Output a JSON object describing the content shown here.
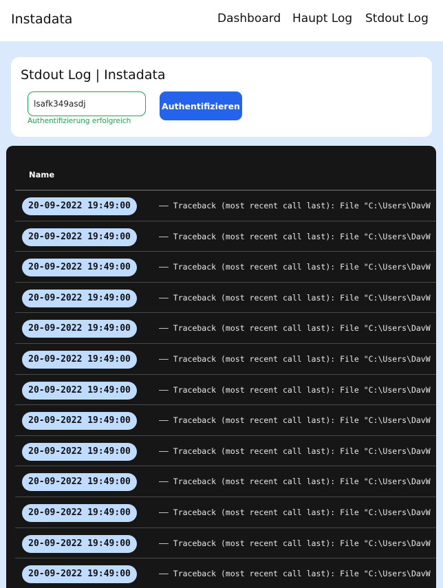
{
  "header": {
    "brand": "Instadata",
    "nav": [
      "Dashboard",
      "Haupt Log",
      "Stdout Log"
    ]
  },
  "auth": {
    "title": "Stdout Log | Instadata",
    "token_value": "lsafk349asdj",
    "status_text": "Authentifizierung erfolgreich",
    "button_label": "Authentifizieren"
  },
  "log": {
    "column_header": "Name",
    "rows": [
      {
        "timestamp": "20-09-2022 19:49:00",
        "message": "—— Traceback (most recent call last): File \"C:\\Users\\DavW"
      },
      {
        "timestamp": "20-09-2022 19:49:00",
        "message": "—— Traceback (most recent call last): File \"C:\\Users\\DavW"
      },
      {
        "timestamp": "20-09-2022 19:49:00",
        "message": "—— Traceback (most recent call last): File \"C:\\Users\\DavW"
      },
      {
        "timestamp": "20-09-2022 19:49:00",
        "message": "—— Traceback (most recent call last): File \"C:\\Users\\DavW"
      },
      {
        "timestamp": "20-09-2022 19:49:00",
        "message": "—— Traceback (most recent call last): File \"C:\\Users\\DavW"
      },
      {
        "timestamp": "20-09-2022 19:49:00",
        "message": "—— Traceback (most recent call last): File \"C:\\Users\\DavW"
      },
      {
        "timestamp": "20-09-2022 19:49:00",
        "message": "—— Traceback (most recent call last): File \"C:\\Users\\DavW"
      },
      {
        "timestamp": "20-09-2022 19:49:00",
        "message": "—— Traceback (most recent call last): File \"C:\\Users\\DavW"
      },
      {
        "timestamp": "20-09-2022 19:49:00",
        "message": "—— Traceback (most recent call last): File \"C:\\Users\\DavW"
      },
      {
        "timestamp": "20-09-2022 19:49:00",
        "message": "—— Traceback (most recent call last): File \"C:\\Users\\DavW"
      },
      {
        "timestamp": "20-09-2022 19:49:00",
        "message": "—— Traceback (most recent call last): File \"C:\\Users\\DavW"
      },
      {
        "timestamp": "20-09-2022 19:49:00",
        "message": "—— Traceback (most recent call last): File \"C:\\Users\\DavW"
      },
      {
        "timestamp": "20-09-2022 19:49:00",
        "message": "—— Traceback (most recent call last): File \"C:\\Users\\DavW"
      }
    ]
  },
  "colors": {
    "background": "#dbe9fd",
    "accent": "#2563eb",
    "success": "#1fa54a",
    "badge": "#bfdbfe",
    "panel": "#161616"
  }
}
